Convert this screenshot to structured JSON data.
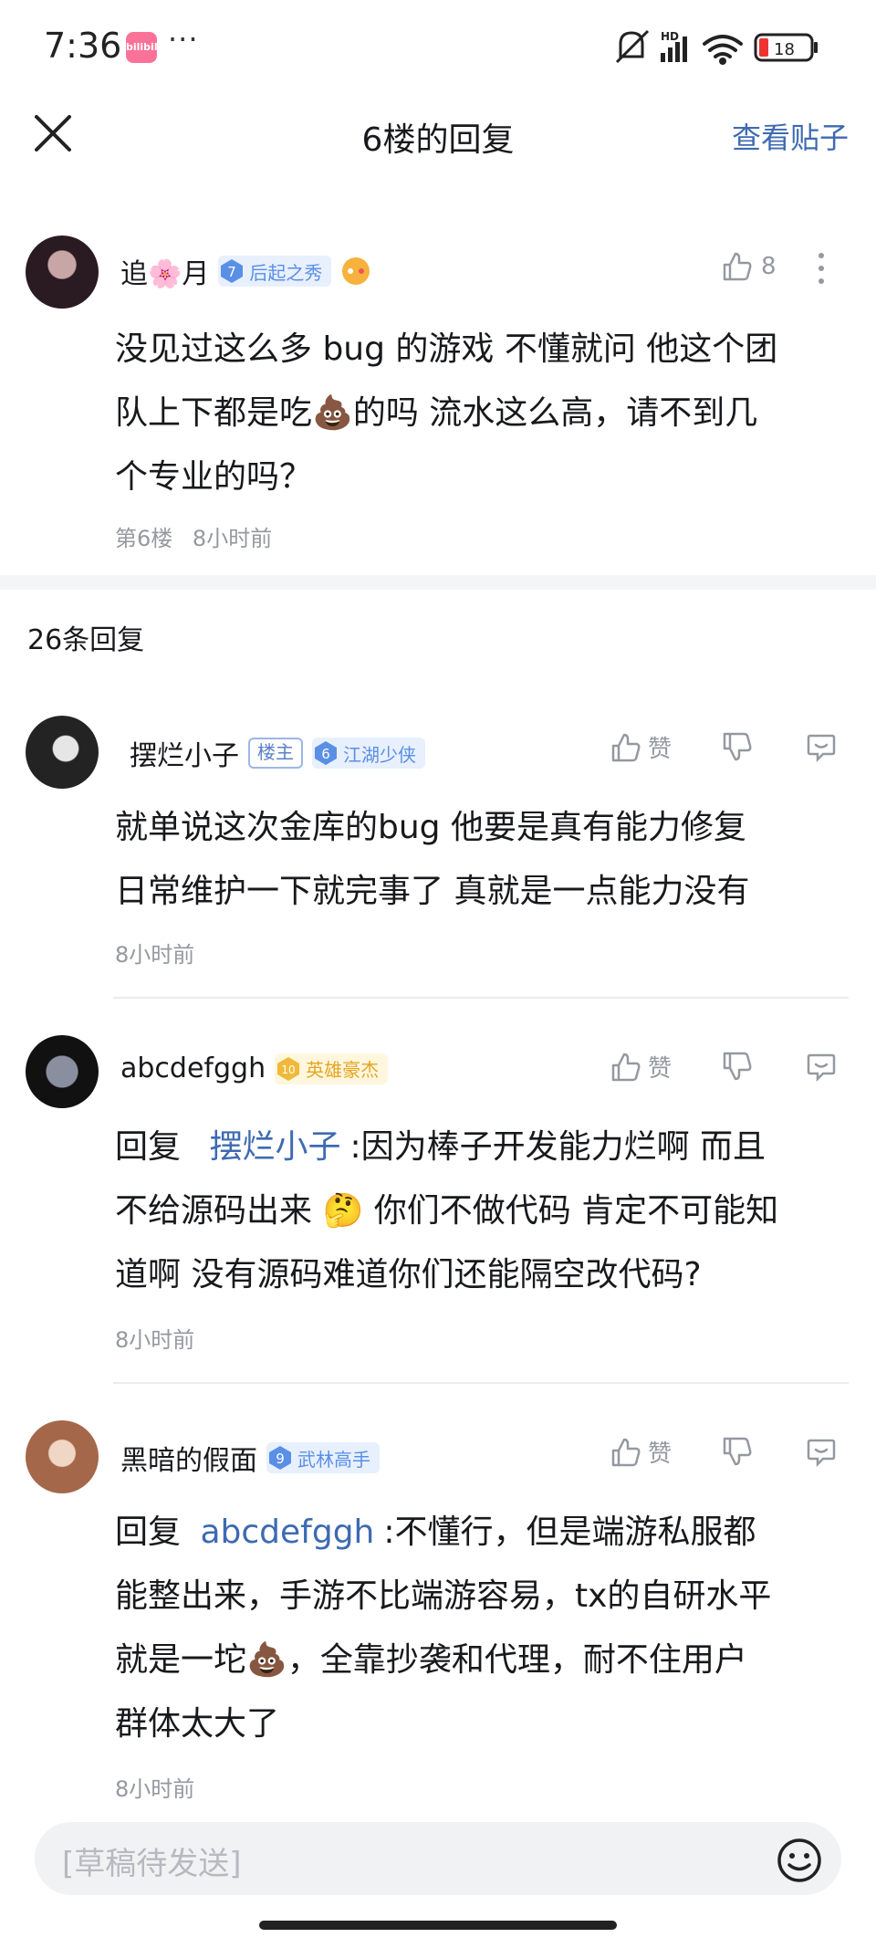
{
  "status": {
    "time": "7:36",
    "app_badge": "bilibili",
    "more": "···",
    "network": "HD",
    "battery": "18"
  },
  "header": {
    "title": "6楼的回复",
    "view_post": "查看贴子"
  },
  "main_comment": {
    "user": "追🌸月",
    "level": "7",
    "title": "后起之秀",
    "likes": "8",
    "text_lines": [
      "没见过这么多 bug 的游戏 不懂就问 他这个团",
      "队上下都是吃💩的吗 流水这么高，请不到几",
      "个专业的吗？"
    ],
    "floor": "第6楼",
    "time": "8小时前"
  },
  "replies_count": "26条回复",
  "replies": [
    {
      "user": "摆烂小子",
      "owner_tag": "楼主",
      "level": "6",
      "title": "江湖少侠",
      "like_label": "赞",
      "lines": [
        "就单说这次金库的bug 他要是真有能力修复",
        "日常维护一下就完事了 真就是一点能力没有"
      ],
      "time": "8小时前"
    },
    {
      "user": "abcdefggh",
      "level": "10",
      "title": "英雄豪杰",
      "like_label": "赞",
      "reply_prefix": "回复",
      "mention": "摆烂小子",
      "lines": [
        ":因为棒子开发能力烂啊 而且",
        "不给源码出来 🤔 你们不做代码 肯定不可能知",
        "道啊 没有源码难道你们还能隔空改代码?"
      ],
      "time": "8小时前"
    },
    {
      "user": "黑暗的假面",
      "level": "9",
      "title": "武林高手",
      "like_label": "赞",
      "reply_prefix": "回复",
      "mention": "abcdefggh",
      "lines": [
        ":不懂行，但是端游私服都",
        "能整出来，手游不比端游容易，tx的自研水平",
        "就是一坨💩，全靠抄袭和代理，耐不住用户",
        "群体太大了"
      ],
      "time": "8小时前"
    }
  ],
  "composer": {
    "placeholder": "[草稿待发送]"
  },
  "colors": {
    "accent": "#3e6ab1",
    "meta": "#9499a0",
    "level_blue": "#5a8fe6",
    "level_gold": "#e3a623"
  }
}
